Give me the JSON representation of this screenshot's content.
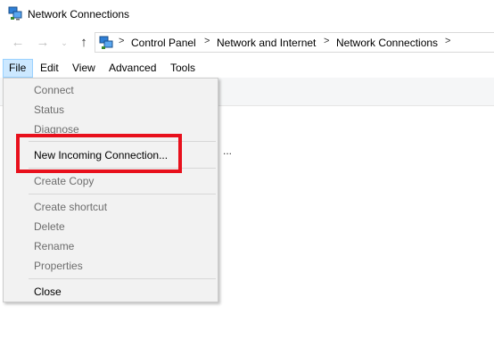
{
  "window": {
    "title": "Network Connections"
  },
  "address_bar": {
    "breadcrumbs": [
      "Control Panel",
      "Network and Internet",
      "Network Connections"
    ],
    "separator": ">"
  },
  "menubar": {
    "items": [
      "File",
      "Edit",
      "View",
      "Advanced",
      "Tools"
    ],
    "active": "File"
  },
  "file_menu": {
    "items": [
      {
        "label": "Connect",
        "enabled": false
      },
      {
        "label": "Status",
        "enabled": false
      },
      {
        "label": "Diagnose",
        "enabled": false
      },
      {
        "label": "New Incoming Connection...",
        "enabled": true
      },
      {
        "label": "Create Copy",
        "enabled": false
      },
      {
        "label": "Create shortcut",
        "enabled": false
      },
      {
        "label": "Delete",
        "enabled": false
      },
      {
        "label": "Rename",
        "enabled": false
      },
      {
        "label": "Properties",
        "enabled": false
      },
      {
        "label": "Close",
        "enabled": true
      }
    ]
  },
  "content_peek": "...",
  "icons": {
    "app": "network-connections-icon",
    "back": "back-arrow-icon",
    "forward": "forward-arrow-icon",
    "recent": "chevron-down-icon",
    "up": "up-arrow-icon"
  },
  "colors": {
    "highlight": "#e8101c",
    "menu_active_bg": "#cce8ff"
  }
}
